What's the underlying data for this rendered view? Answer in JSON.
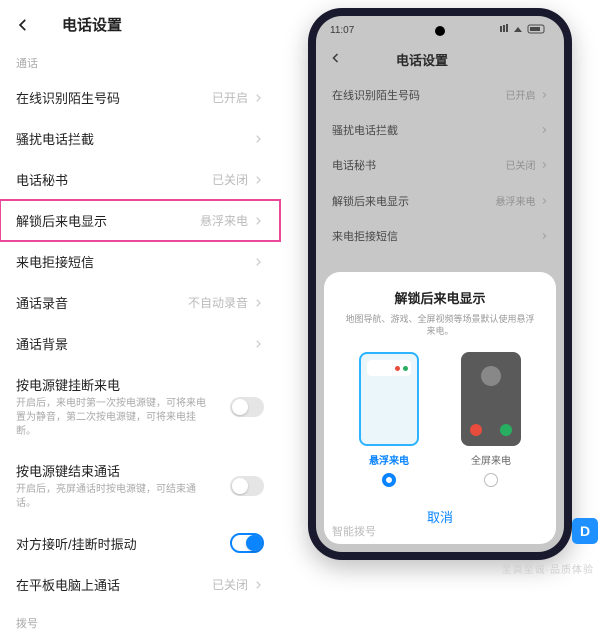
{
  "left": {
    "title": "电话设置",
    "section_call": "通话",
    "rows": {
      "online_id": {
        "label": "在线识别陌生号码",
        "value": "已开启"
      },
      "block": {
        "label": "骚扰电话拦截"
      },
      "secretary": {
        "label": "电话秘书",
        "value": "已关闭"
      },
      "unlock_incoming": {
        "label": "解锁后来电显示",
        "value": "悬浮来电"
      },
      "reject_sms": {
        "label": "来电拒接短信"
      },
      "recording": {
        "label": "通话录音",
        "value": "不自动录音"
      },
      "background": {
        "label": "通话背景"
      },
      "power_hangup": {
        "label": "按电源键挂断来电",
        "sub": "开启后，来电时第一次按电源键，可将来电置为静音，第二次按电源键，可将来电挂断。"
      },
      "power_end": {
        "label": "按电源键结束通话",
        "sub": "开启后，亮屏通话时按电源键，可结束通话。"
      },
      "vibrate": {
        "label": "对方接听/挂断时振动"
      },
      "tablet": {
        "label": "在平板电脑上通话",
        "value": "已关闭"
      }
    },
    "section_dial": "拨号"
  },
  "phone": {
    "time": "11:07",
    "title": "电话设置",
    "rows": {
      "online_id": {
        "label": "在线识别陌生号码",
        "value": "已开启"
      },
      "block": {
        "label": "骚扰电话拦截"
      },
      "secretary": {
        "label": "电话秘书",
        "value": "已关闭"
      },
      "unlock_incoming": {
        "label": "解锁后来电显示",
        "value": "悬浮来电"
      },
      "reject_sms": {
        "label": "来电拒接短信"
      },
      "smart_dial": {
        "label": "智能拨号"
      }
    },
    "sheet": {
      "title": "解锁后来电显示",
      "desc": "地图导航、游戏、全屏视频等场景默认使用悬浮来电。",
      "opt_float": "悬浮来电",
      "opt_full": "全屏来电",
      "cancel": "取消"
    }
  },
  "watermark": {
    "badge": "D",
    "text": "至真至诚·品质体验"
  }
}
